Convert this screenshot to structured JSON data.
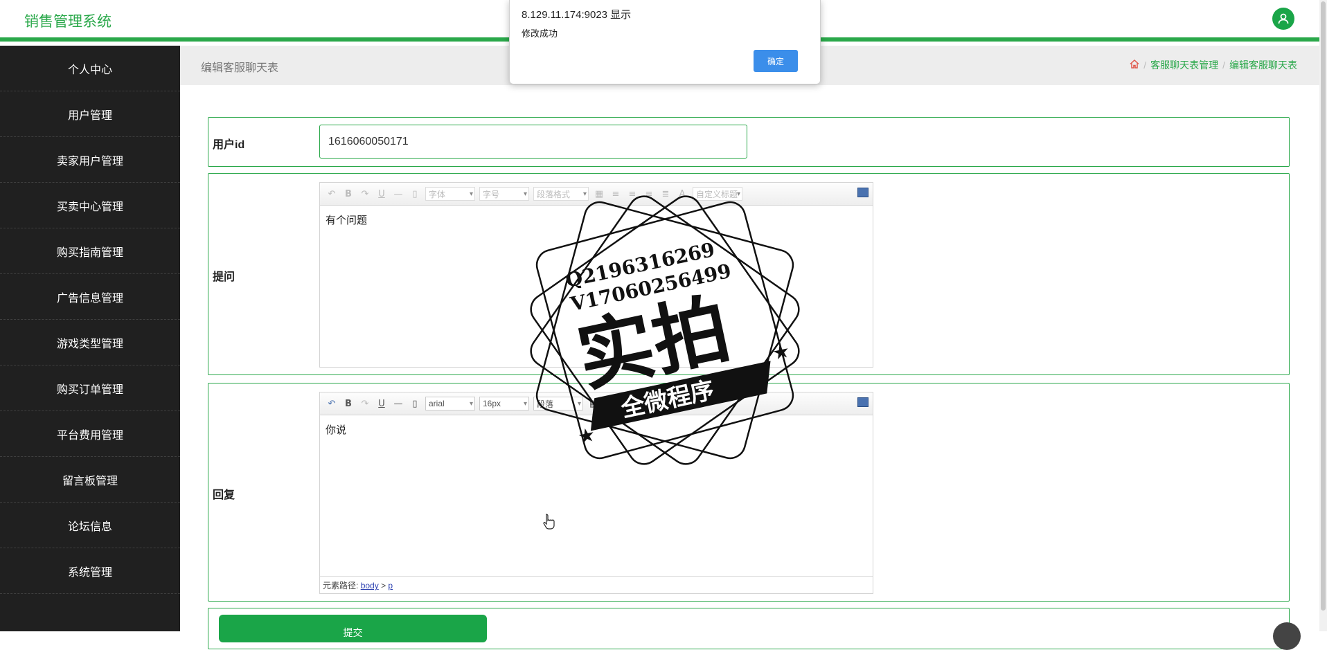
{
  "app": {
    "title": "销售管理系统"
  },
  "sidebar": {
    "items": [
      {
        "label": "个人中心"
      },
      {
        "label": "用户管理"
      },
      {
        "label": "卖家用户管理"
      },
      {
        "label": "买卖中心管理"
      },
      {
        "label": "购买指南管理"
      },
      {
        "label": "广告信息管理"
      },
      {
        "label": "游戏类型管理"
      },
      {
        "label": "购买订单管理"
      },
      {
        "label": "平台费用管理"
      },
      {
        "label": "留言板管理"
      },
      {
        "label": "论坛信息"
      },
      {
        "label": "系统管理"
      }
    ]
  },
  "page": {
    "title": "编辑客服聊天表",
    "breadcrumb": [
      "客服聊天表管理",
      "编辑客服聊天表"
    ]
  },
  "form": {
    "user_id": {
      "label": "用户id",
      "value": "1616060050171"
    },
    "question": {
      "label": "提问",
      "content": "有个问题"
    },
    "reply": {
      "label": "回复",
      "content": "你说"
    },
    "editor_font": "字体",
    "editor_size": "字号",
    "editor_paragraph": "段落格式",
    "editor_custom": "自定义标题",
    "reply_font": "arial",
    "reply_size": "16px",
    "reply_paragraph": "段落",
    "element_path_label": "元素路径:",
    "element_path": [
      "body",
      "p"
    ],
    "submit_label": "提交"
  },
  "alert": {
    "host": "8.129.11.174:9023 显示",
    "message": "修改成功",
    "ok_label": "确定"
  },
  "watermark": {
    "line1": "Q2196316269",
    "line2": "V17060256499",
    "big": "实拍",
    "banner": "全微程序"
  },
  "colors": {
    "accent": "#2aa84a",
    "sidebar": "#202020",
    "dialog_button": "#3b8eea"
  }
}
